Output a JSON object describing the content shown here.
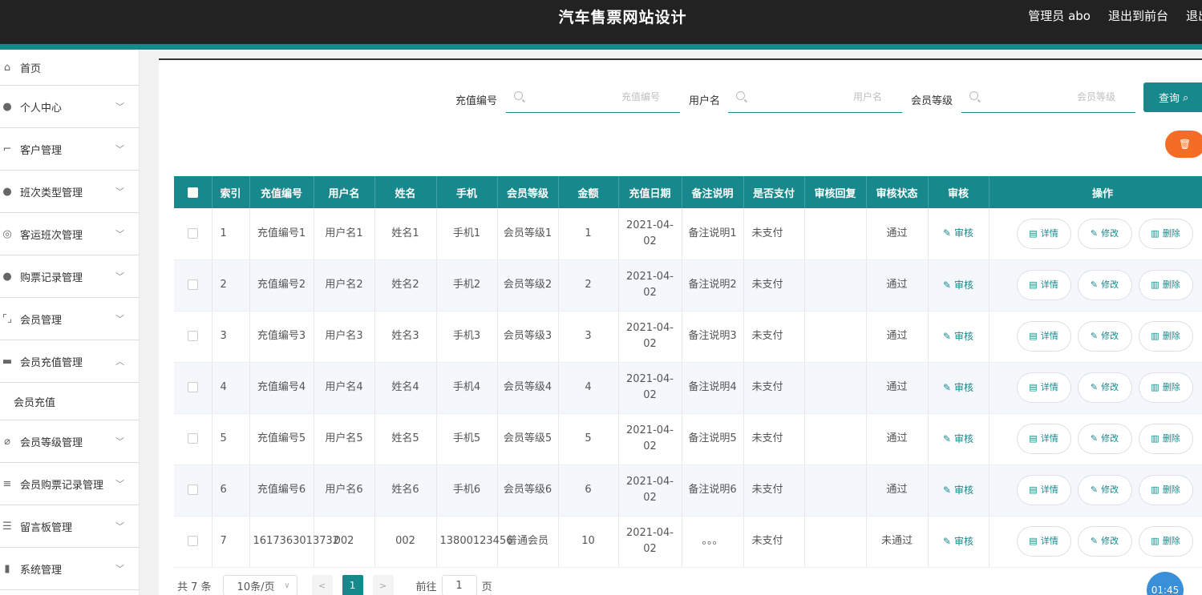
{
  "header": {
    "title": "汽车售票网站设计",
    "links": [
      "管理员 abo",
      "退出到前台",
      "退出"
    ]
  },
  "sidebar": {
    "items": [
      {
        "label": "首页",
        "icon": "home-icon",
        "expanded": false
      },
      {
        "label": "个人中心",
        "icon": "user-icon",
        "expanded": false
      },
      {
        "label": "客户管理",
        "icon": "crop-icon",
        "expanded": false
      },
      {
        "label": "班次类型管理",
        "icon": "user-icon",
        "expanded": false
      },
      {
        "label": "客运班次管理",
        "icon": "compass-icon",
        "expanded": false
      },
      {
        "label": "购票记录管理",
        "icon": "location-icon",
        "expanded": false
      },
      {
        "label": "会员管理",
        "icon": "frame-icon",
        "expanded": false
      },
      {
        "label": "会员充值管理",
        "icon": "ticket-icon",
        "expanded": true
      },
      {
        "label": "会员等级管理",
        "icon": "bell-off-icon",
        "expanded": false
      },
      {
        "label": "会员购票记录管理",
        "icon": "list-icon",
        "expanded": false
      },
      {
        "label": "留言板管理",
        "icon": "sliders-icon",
        "expanded": false
      },
      {
        "label": "系统管理",
        "icon": "bars-icon",
        "expanded": false
      }
    ],
    "submenu": {
      "label": "会员充值"
    }
  },
  "search": {
    "field1_label": "充值编号",
    "field1_placeholder": "充值编号",
    "field2_label": "用户名",
    "field2_placeholder": "用户名",
    "field3_label": "会员等级",
    "field3_placeholder": "会员等级",
    "query_label": "查询"
  },
  "table": {
    "headers": [
      "索引",
      "充值编号",
      "用户名",
      "姓名",
      "手机",
      "会员等级",
      "金额",
      "充值日期",
      "备注说明",
      "是否支付",
      "审核回复",
      "审核状态",
      "审核",
      "操作"
    ],
    "audit_label": "审核",
    "detail_label": "详情",
    "edit_label": "修改",
    "delete_label": "删除",
    "rows": [
      {
        "idx": "1",
        "no": "充值编号1",
        "user": "用户名1",
        "name": "姓名1",
        "phone": "手机1",
        "level": "会员等级1",
        "amount": "1",
        "date": "2021-04-02",
        "remark": "备注说明1",
        "paid": "未支付",
        "reply": "",
        "status": "通过"
      },
      {
        "idx": "2",
        "no": "充值编号2",
        "user": "用户名2",
        "name": "姓名2",
        "phone": "手机2",
        "level": "会员等级2",
        "amount": "2",
        "date": "2021-04-02",
        "remark": "备注说明2",
        "paid": "未支付",
        "reply": "",
        "status": "通过"
      },
      {
        "idx": "3",
        "no": "充值编号3",
        "user": "用户名3",
        "name": "姓名3",
        "phone": "手机3",
        "level": "会员等级3",
        "amount": "3",
        "date": "2021-04-02",
        "remark": "备注说明3",
        "paid": "未支付",
        "reply": "",
        "status": "通过"
      },
      {
        "idx": "4",
        "no": "充值编号4",
        "user": "用户名4",
        "name": "姓名4",
        "phone": "手机4",
        "level": "会员等级4",
        "amount": "4",
        "date": "2021-04-02",
        "remark": "备注说明4",
        "paid": "未支付",
        "reply": "",
        "status": "通过"
      },
      {
        "idx": "5",
        "no": "充值编号5",
        "user": "用户名5",
        "name": "姓名5",
        "phone": "手机5",
        "level": "会员等级5",
        "amount": "5",
        "date": "2021-04-02",
        "remark": "备注说明5",
        "paid": "未支付",
        "reply": "",
        "status": "通过"
      },
      {
        "idx": "6",
        "no": "充值编号6",
        "user": "用户名6",
        "name": "姓名6",
        "phone": "手机6",
        "level": "会员等级6",
        "amount": "6",
        "date": "2021-04-02",
        "remark": "备注说明6",
        "paid": "未支付",
        "reply": "",
        "status": "通过"
      },
      {
        "idx": "7",
        "no": "1617363013732",
        "user": "002",
        "name": "002",
        "phone": "13800123456",
        "level": "普通会员",
        "amount": "10",
        "date": "2021-04-02",
        "remark": "。。。",
        "paid": "未支付",
        "reply": "",
        "status": "未通过"
      }
    ]
  },
  "pagination": {
    "total": "共 7 条",
    "page_size": "10条/页",
    "current_page": "1",
    "goto_label": "前往",
    "goto_value": "1",
    "page_suffix": "页"
  },
  "timer": "01:45",
  "colors": {
    "accent": "#17888b",
    "header_bg": "#222222",
    "delete_round": "#f56c24"
  }
}
